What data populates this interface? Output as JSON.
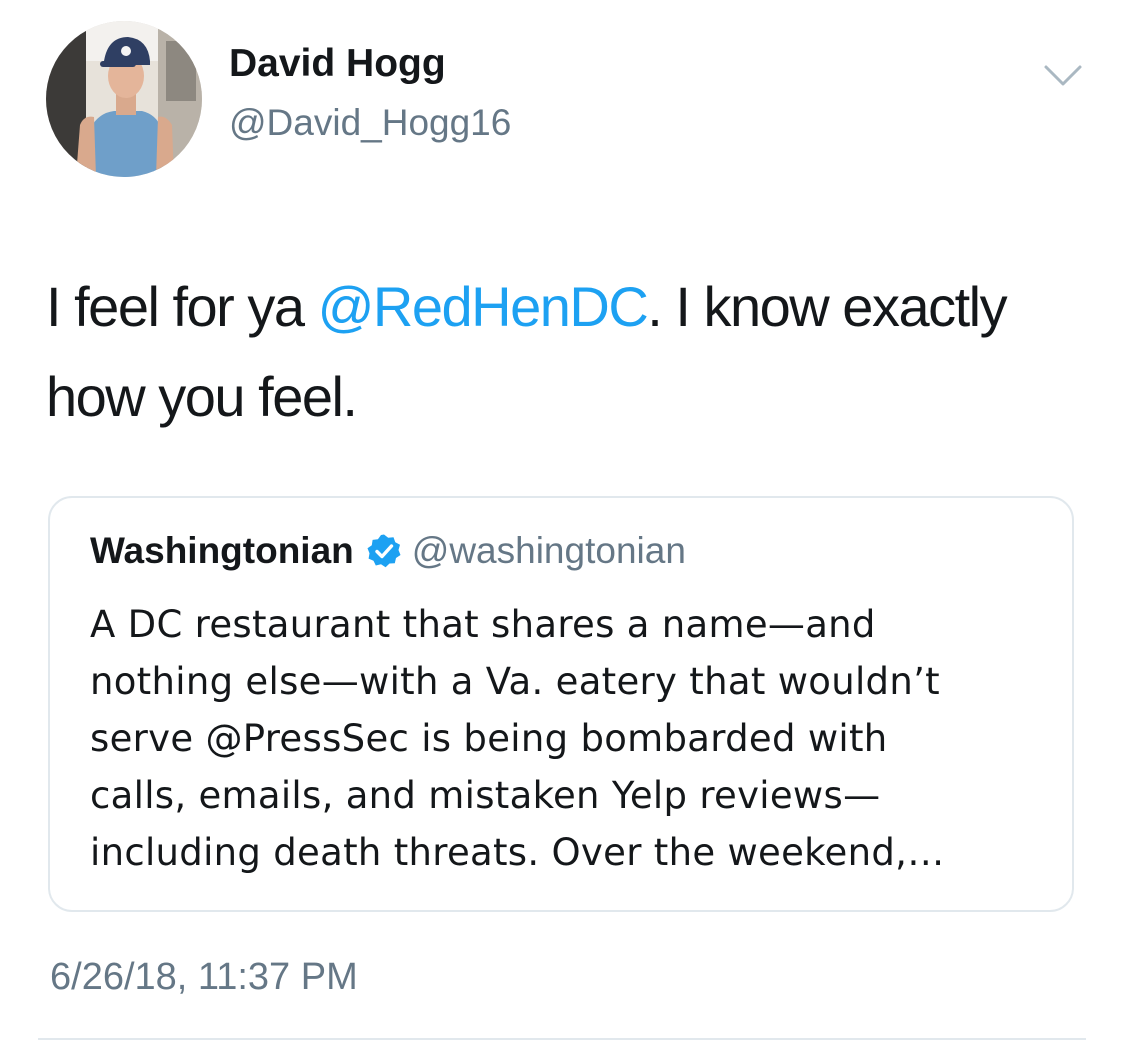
{
  "author": {
    "display_name": "David Hogg",
    "handle": "@David_Hogg16",
    "avatar_icon": "profile-photo"
  },
  "menu": {
    "icon": "chevron-down-icon"
  },
  "tweet": {
    "text_before": "I feel for ya ",
    "mention": "@RedHenDC",
    "text_after": ".  I know exactly how you feel."
  },
  "quoted_tweet": {
    "display_name": "Washingtonian",
    "verified_icon": "verified-badge-icon",
    "handle": "@washingtonian",
    "lines": [
      "A DC restaurant that shares a name—and",
      "nothing else—with a Va. eatery that wouldn’t",
      "serve @PressSec is being bombarded with",
      "calls, emails, and mistaken Yelp reviews—",
      "including death threats. Over the weekend,…"
    ]
  },
  "timestamp": "6/26/18, 11:37 PM",
  "colors": {
    "link": "#1da1f2",
    "secondary_text": "#657786",
    "border": "#e1e8ed",
    "primary_text": "#14171a"
  }
}
